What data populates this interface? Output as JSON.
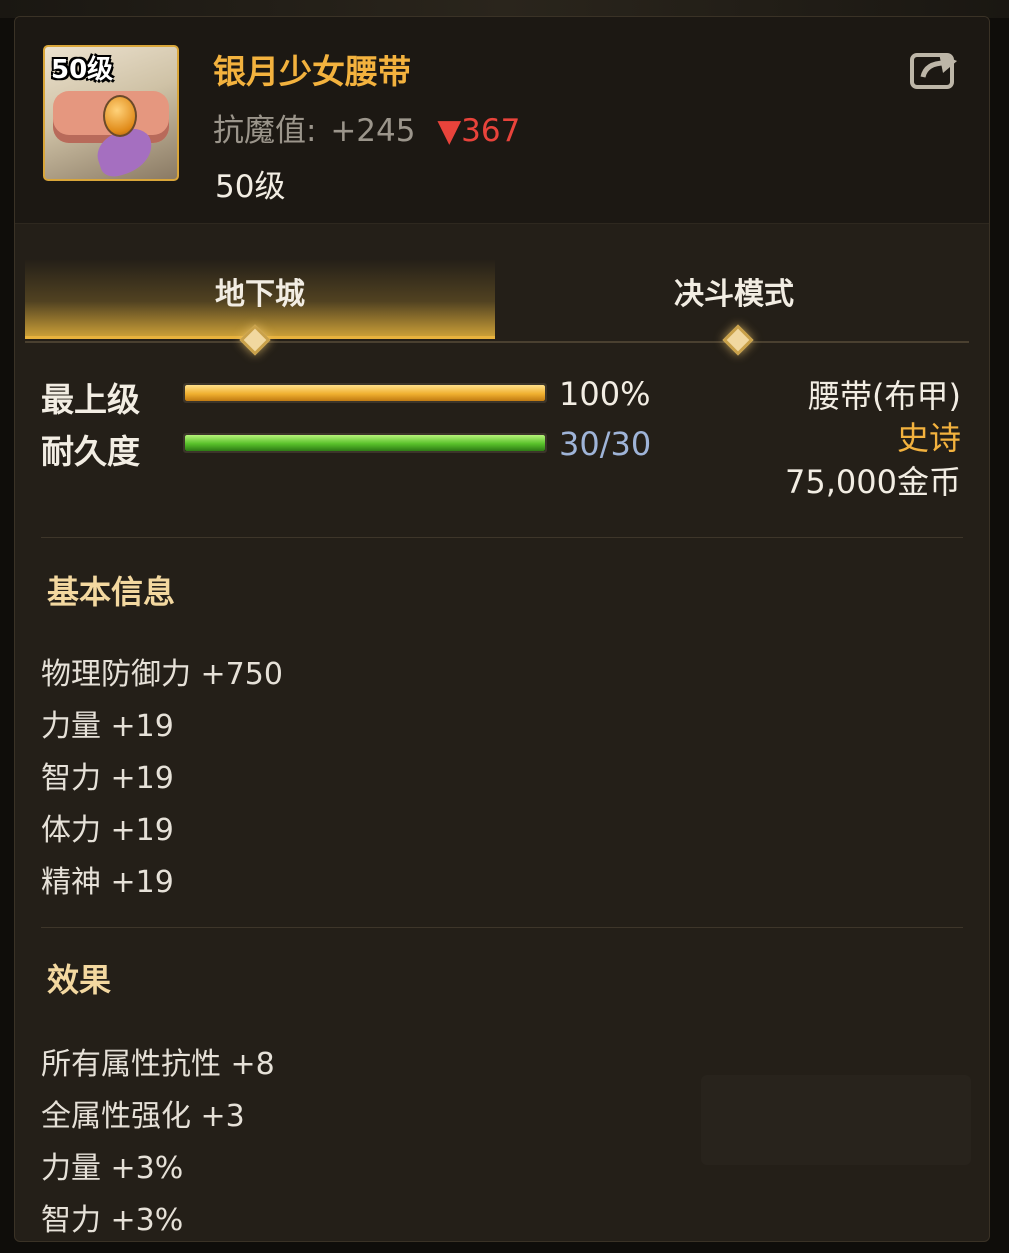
{
  "item": {
    "icon_level": "50级",
    "name": "银月少女腰带",
    "resist_label": "抗魔值:",
    "resist_value": "+245",
    "resist_diff": "▼367",
    "level": "50级",
    "share_icon": "share-export-icon"
  },
  "tabs": [
    {
      "label": "地下城",
      "active": true
    },
    {
      "label": "决斗模式",
      "active": false
    }
  ],
  "stats": {
    "grade": {
      "label": "最上级",
      "value": "100%",
      "fraction": 1.0,
      "value_color": "#f2ede3"
    },
    "durability": {
      "label": "耐久度",
      "value": "30/30",
      "fraction": 1.0,
      "value_color": "#9fb4d8"
    }
  },
  "side_info": {
    "type": "腰带(布甲)",
    "rarity": "史诗",
    "price": "75,000金币"
  },
  "colors": {
    "name": "#f3b23e",
    "rarity": "#f3b23e",
    "diff_down": "#e8433b"
  },
  "basic": {
    "title": "基本信息",
    "lines": [
      "物理防御力 +750",
      "力量 +19",
      "智力 +19",
      "体力 +19",
      "精神 +19"
    ]
  },
  "effects": {
    "title": "效果",
    "lines": [
      "所有属性抗性 +8",
      "全属性强化 +3",
      "力量 +3%",
      "智力 +3%"
    ]
  }
}
